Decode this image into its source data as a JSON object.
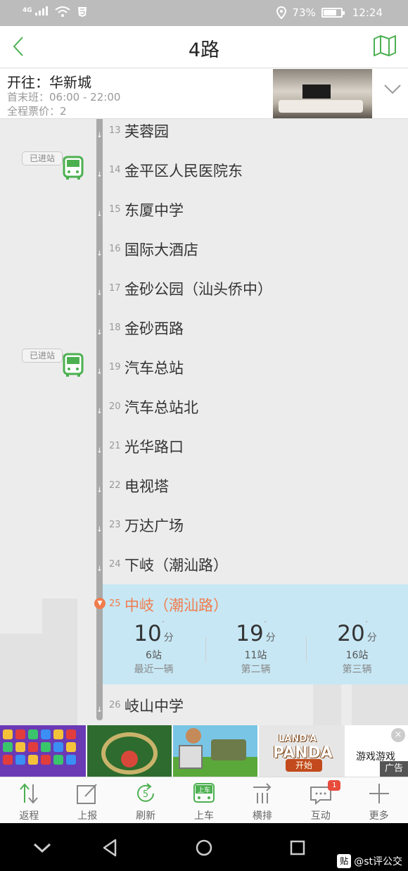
{
  "status_bar": {
    "network": "4G",
    "battery": "73%",
    "time": "12:24"
  },
  "header": {
    "title": "4路"
  },
  "info": {
    "destination": "开往：华新城",
    "hours": "首末班：06:00 - 22:00",
    "fare": "全程票价：2"
  },
  "stops": [
    {
      "num": "13",
      "name": "芙蓉园"
    },
    {
      "num": "14",
      "name": "金平区人民医院东"
    },
    {
      "num": "15",
      "name": "东厦中学"
    },
    {
      "num": "16",
      "name": "国际大酒店"
    },
    {
      "num": "17",
      "name": "金砂公园（汕头侨中）"
    },
    {
      "num": "18",
      "name": "金砂西路"
    },
    {
      "num": "19",
      "name": "汽车总站"
    },
    {
      "num": "20",
      "name": "汽车总站北"
    },
    {
      "num": "21",
      "name": "光华路口"
    },
    {
      "num": "22",
      "name": "电视塔"
    },
    {
      "num": "23",
      "name": "万达广场"
    },
    {
      "num": "24",
      "name": "下岐（潮汕路）"
    },
    {
      "num": "25",
      "name": "中岐（潮汕路）"
    },
    {
      "num": "26",
      "name": "岐山中学"
    }
  ],
  "bus_badges": [
    "已进站",
    "已进站"
  ],
  "current_stop": {
    "etas": [
      {
        "value": "10",
        "unit": "分",
        "stations": "6站",
        "label": "最近一辆"
      },
      {
        "value": "19",
        "unit": "分",
        "stations": "11站",
        "label": "第二辆"
      },
      {
        "value": "20",
        "unit": "分",
        "stations": "16站",
        "label": "第三辆"
      }
    ]
  },
  "ad": {
    "panda_line1": "LAND'A",
    "panda_line2": "PANDA",
    "start_button": "开始",
    "text": "游戏游戏",
    "tag": "广告",
    "close": "×"
  },
  "toolbar": {
    "items": [
      {
        "label": "返程",
        "icon": "swap-arrows-icon"
      },
      {
        "label": "上报",
        "icon": "edit-note-icon"
      },
      {
        "label": "刷新",
        "icon": "refresh-icon"
      },
      {
        "label": "上车",
        "icon": "board-bus-icon",
        "icon_text": "上车"
      },
      {
        "label": "横排",
        "icon": "horizontal-layout-icon"
      },
      {
        "label": "互动",
        "icon": "chat-icon",
        "badge": "1"
      },
      {
        "label": "更多",
        "icon": "plus-icon"
      }
    ],
    "refresh_icon_text": "5"
  },
  "watermark": {
    "logo": "贴",
    "text": "@st评公交"
  },
  "colors": {
    "accent_green": "#4cb050",
    "highlight_orange": "#f07c4d",
    "current_bg": "#c7e7f4"
  }
}
